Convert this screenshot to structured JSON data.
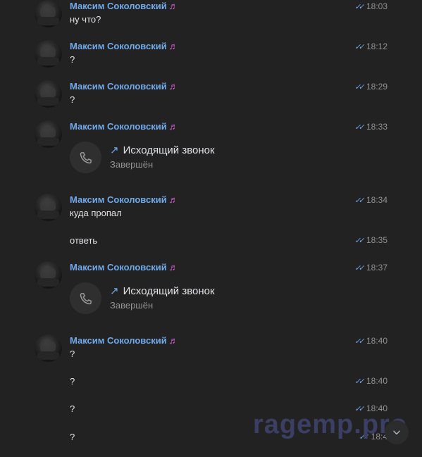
{
  "watermark": "ragemp.pro",
  "messages": [
    {
      "author": "Максим Соколовский",
      "note": "♬",
      "text": "ну что?",
      "time": "18:03"
    },
    {
      "author": "Максим Соколовский",
      "note": "♬",
      "text": "?",
      "time": "18:12"
    },
    {
      "author": "Максим Соколовский",
      "note": "♬",
      "text": "?",
      "time": "18:29"
    },
    {
      "author": "Максим Соколовский",
      "note": "♬",
      "call_title": "Исходящий звонок",
      "call_status": "Завершён",
      "time": "18:33"
    },
    {
      "author": "Максим Соколовский",
      "note": "♬",
      "text": "куда пропал",
      "time": "18:34"
    },
    {
      "text": "ответь",
      "time": "18:35"
    },
    {
      "author": "Максим Соколовский",
      "note": "♬",
      "call_title": "Исходящий звонок",
      "call_status": "Завершён",
      "time": "18:37"
    },
    {
      "author": "Максим Соколовский",
      "note": "♬",
      "text": "?",
      "time": "18:40"
    },
    {
      "text": "?",
      "time": "18:40"
    },
    {
      "text": "?",
      "time": "18:40"
    },
    {
      "text": "?",
      "time": "18:4"
    }
  ]
}
